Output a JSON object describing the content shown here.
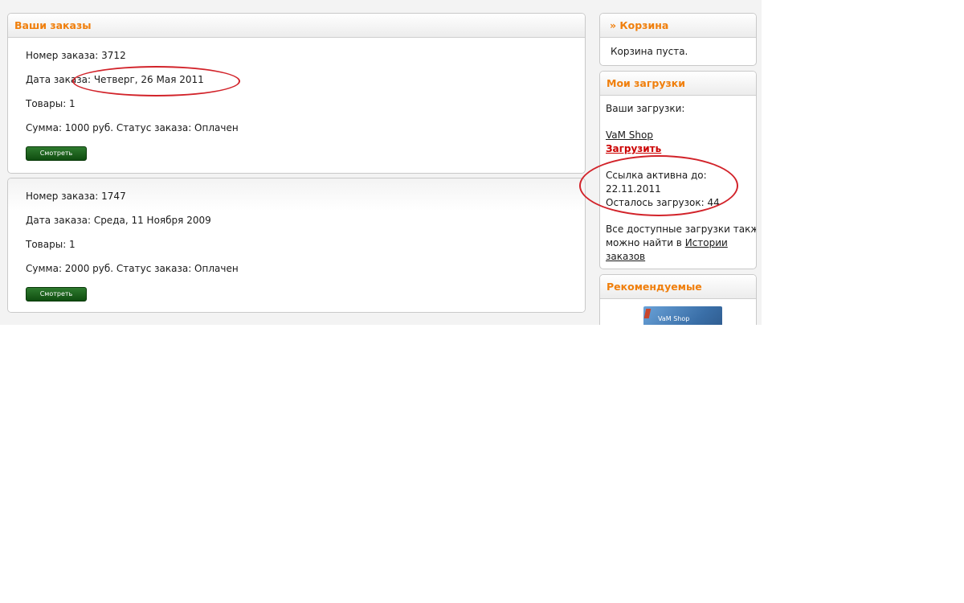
{
  "orders_panel": {
    "title": "Ваши заказы"
  },
  "orders": [
    {
      "number_label": "Номер заказа: 3712",
      "date_label": "Дата заказа: Четверг, 26 Мая 2011",
      "items_label": "Товары: 1",
      "sum_status_label": "Сумма: 1000 руб.  Статус заказа: Оплачен",
      "button_label": "Смотреть"
    },
    {
      "number_label": "Номер заказа: 1747",
      "date_label": "Дата заказа: Среда, 11 Ноября 2009",
      "items_label": "Товары: 1",
      "sum_status_label": "Сумма: 2000 руб.  Статус заказа: Оплачен",
      "button_label": "Смотреть"
    }
  ],
  "cart": {
    "title": "» Корзина",
    "empty_text": "Корзина пуста."
  },
  "downloads": {
    "title": "Мои загрузки",
    "your_downloads": "Ваши загрузки:",
    "product_link": "VaM Shop",
    "download_link": "Загрузить",
    "active_until_label": "Ссылка активна до:",
    "active_until_date": "22.11.2011",
    "remaining": "Осталось загрузок: 44",
    "note_line1": "Все доступные загрузки также",
    "note_line2_prefix": "можно найти в ",
    "history_link_part1": "Истории",
    "history_link_part2": "заказов"
  },
  "recommended": {
    "title": "Рекомендуемые",
    "product_caption": "VaM Shop"
  },
  "colors": {
    "accent_orange": "#f07f0c",
    "button_green": "#0f4d10",
    "annotation_red": "#d2232a",
    "link_red": "#cc0000"
  }
}
